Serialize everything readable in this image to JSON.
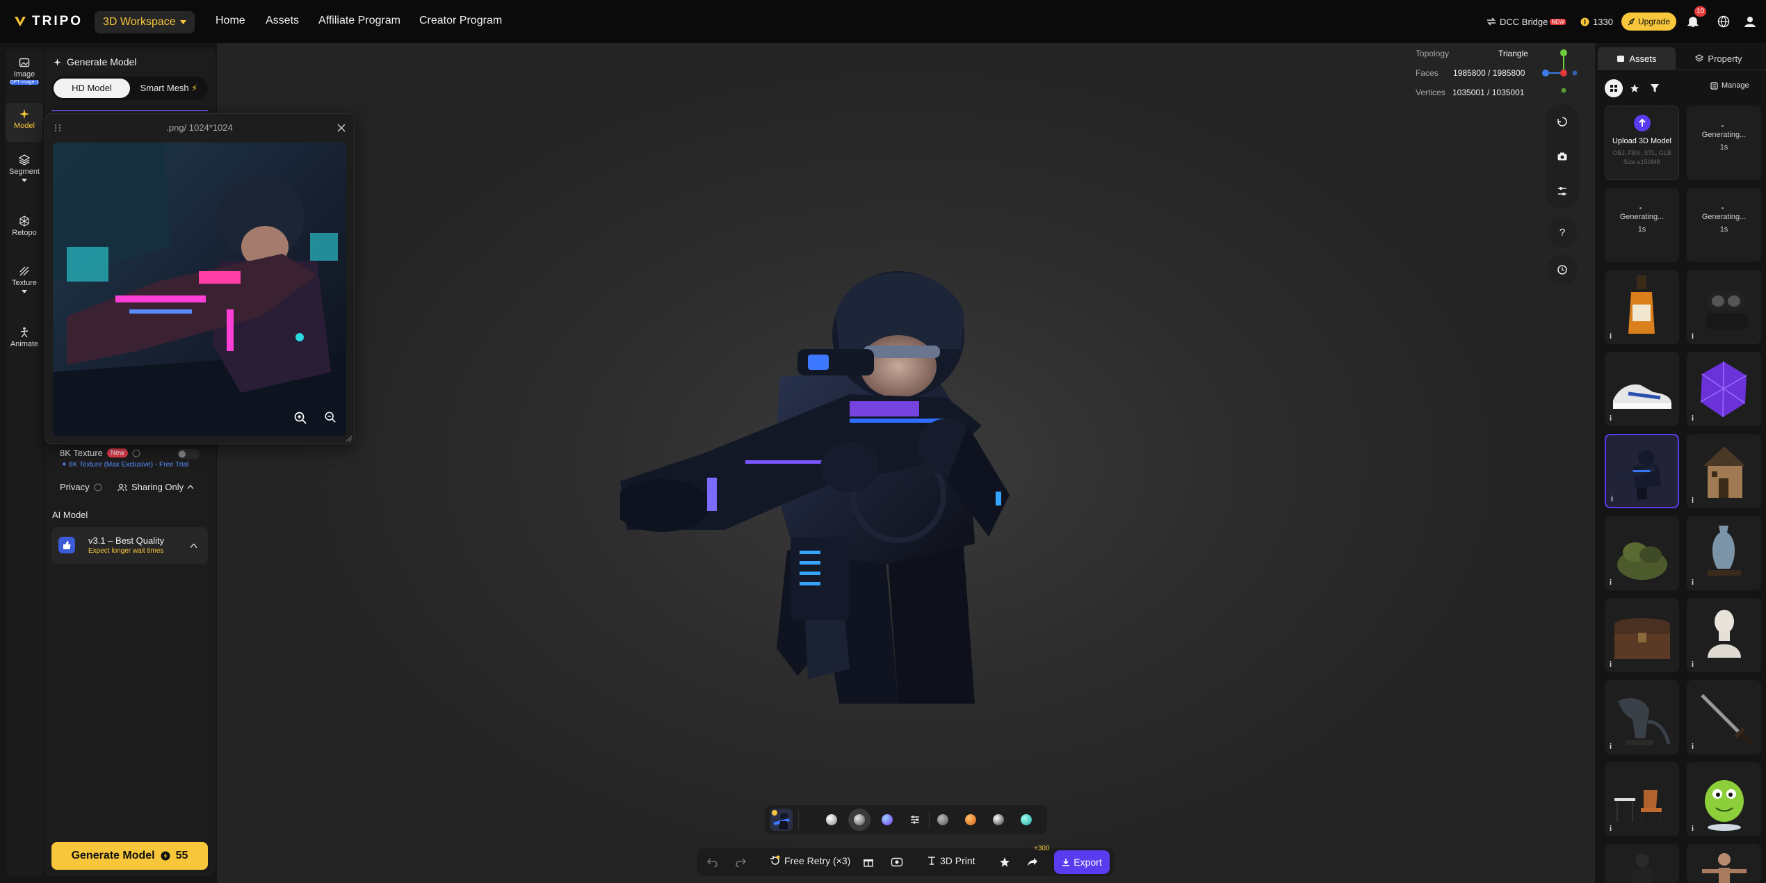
{
  "topbar": {
    "logo_text": "TRIPO",
    "workspace_label": "3D Workspace",
    "nav": [
      "Home",
      "Assets",
      "Affiliate Program",
      "Creator Program"
    ],
    "dcc_label": "DCC Bridge",
    "dcc_badge": "NEW",
    "credits": "1330",
    "upgrade_label": "Upgrade",
    "notif_count": "10",
    "accent": "#f7c63a"
  },
  "rail": {
    "items": [
      {
        "label": "Image",
        "sub": "GPT-image-1",
        "icon": "image-icon"
      },
      {
        "label": "Model",
        "icon": "sparkle-icon",
        "active": true
      },
      {
        "label": "Segment",
        "icon": "segment-icon"
      },
      {
        "label": "Retopo",
        "icon": "retopo-icon"
      },
      {
        "label": "Texture",
        "icon": "texture-icon"
      },
      {
        "label": "Animate",
        "icon": "animate-icon"
      }
    ]
  },
  "panel": {
    "title": "Generate Model",
    "modes": [
      "HD Model",
      "Smart Mesh"
    ],
    "texture_8k_label": "8K Texture",
    "texture_8k_tag": "New",
    "texture_8k_note": "8K Texture (Max Exclusive) - Free Trial",
    "privacy_label": "Privacy",
    "sharing_label": "Sharing Only",
    "ai_model_heading": "AI Model",
    "ai_model_name": "v3.1 – Best Quality",
    "ai_model_note": "Expect longer wait times",
    "generate_label": "Generate Model",
    "generate_cost": "55"
  },
  "preview": {
    "title": ".png/ 1024*1024"
  },
  "viewport": {
    "stats": [
      {
        "label": "Topology",
        "value": "Triangle"
      },
      {
        "label": "Faces",
        "value": "1985800 / 1985800"
      },
      {
        "label": "Vertices",
        "value": "1035001 / 1035001"
      }
    ],
    "gizmo_colors": {
      "x": "#e5393b",
      "y": "#6fcf3a",
      "z": "#3d7be8"
    }
  },
  "actions": {
    "retry_label": "Free Retry (×3)",
    "print_label": "3D Print",
    "share_bonus": "+300",
    "export_label": "Export"
  },
  "assets": {
    "tabs": [
      "Assets",
      "Property"
    ],
    "manage_label": "Manage",
    "upload_title": "Upload 3D Model",
    "upload_formats": "OBJ, FBX, STL, GLB",
    "upload_size": "Size ≤150MB",
    "generating_label": "Generating...",
    "generating_time": "1s",
    "items": [
      "whisky-bottle",
      "earbuds-case",
      "sneaker",
      "purple-crystal",
      "armored-soldier",
      "medieval-house",
      "mossy-rock",
      "ceramic-vase",
      "treasure-chest",
      "marble-bust",
      "xenomorph-figure",
      "sword",
      "chair-and-table",
      "green-creature",
      "figure-dark",
      "figure-skin"
    ]
  }
}
